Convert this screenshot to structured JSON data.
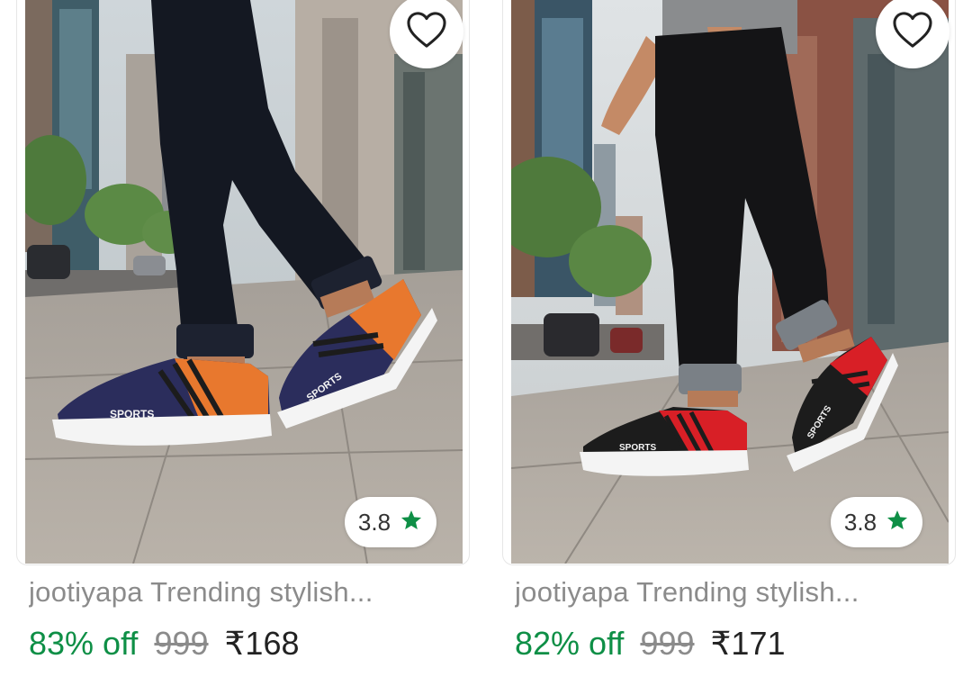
{
  "products": [
    {
      "title": "jootiyapa Trending stylish...",
      "rating": "3.8",
      "discount": "83% off",
      "mrp": "999",
      "price": "₹168",
      "accent_color": "#e8782e",
      "upper_color": "#2b2d5c",
      "sole_label": "SPORTS"
    },
    {
      "title": "jootiyapa Trending stylish...",
      "rating": "3.8",
      "discount": "82% off",
      "mrp": "999",
      "price": "₹171",
      "accent_color": "#d81f26",
      "upper_color": "#1c1c1c",
      "sole_label": "SPORTS"
    }
  ],
  "icons": {
    "wishlist": "heart-outline-icon",
    "rating": "star-icon"
  },
  "colors": {
    "discount_green": "#0e8f46",
    "star_green": "#0e8f46",
    "muted_text": "#8b8b8b"
  }
}
